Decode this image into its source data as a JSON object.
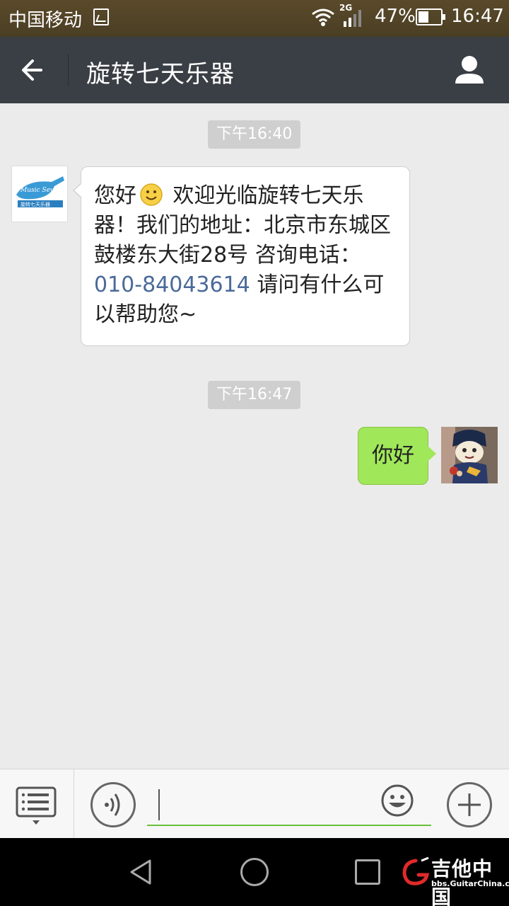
{
  "status_bar": {
    "carrier": "中国移动",
    "network": "2G",
    "battery": "47%",
    "time": "16:47"
  },
  "header": {
    "title": "旋转七天乐器"
  },
  "messages": [
    {
      "timestamp": "下午16:40"
    },
    {
      "sender": "shop",
      "text_part1": "您好",
      "emoji": "smile-emoji",
      "text_part2": " 欢迎光临旋转七天乐器！我们的地址：北京市东城区鼓楼东大街28号 咨询电话：",
      "phone": "010-84043614",
      "text_part3": " 请问有什么可以帮助您~"
    },
    {
      "timestamp": "下午16:47"
    },
    {
      "sender": "me",
      "text": "你好"
    }
  ],
  "shop_avatar": {
    "logo_text": "Music Seven",
    "logo_subtext": "旋转七天乐器"
  },
  "input_bar": {
    "value": "",
    "placeholder": ""
  },
  "watermark": {
    "main": "吉他中国",
    "sub": "bbs.GuitarChina.com"
  },
  "colors": {
    "title_bar": "#3a3f45",
    "outgoing_bubble": "#a0e75a",
    "accent_green": "#6cbf3d",
    "phone_link": "#4a6a9a"
  }
}
